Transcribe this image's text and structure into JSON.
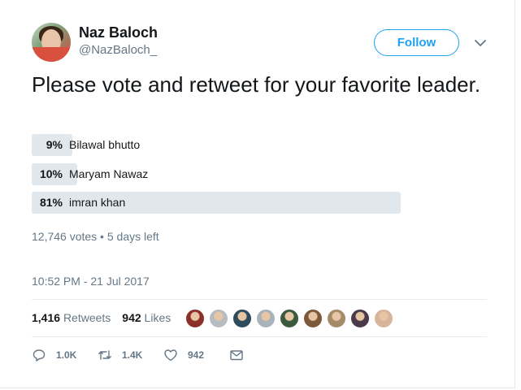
{
  "author": {
    "name": "Naz Baloch",
    "handle": "@NazBaloch_"
  },
  "follow_label": "Follow",
  "tweet_text": "Please vote and retweet for your favorite leader.",
  "poll": {
    "options": [
      {
        "pct_label": "9%",
        "label": "Bilawal bhutto",
        "pct": 9
      },
      {
        "pct_label": "10%",
        "label": "Maryam Nawaz",
        "pct": 10
      },
      {
        "pct_label": "81%",
        "label": "imran khan",
        "pct": 81
      }
    ],
    "meta": "12,746 votes • 5 days left"
  },
  "timestamp": "10:52 PM - 21 Jul 2017",
  "stats": {
    "retweets_count": "1,416",
    "retweets_label": "Retweets",
    "likes_count": "942",
    "likes_label": "Likes"
  },
  "liker_avatar_colors": [
    "#8b2f2a",
    "#b6bcc2",
    "#2f4a5a",
    "#aab2ba",
    "#3a5a3e",
    "#7a5a3a",
    "#a58a6a",
    "#4a3a4a",
    "#d8b49a"
  ],
  "actions": {
    "reply_count": "1.0K",
    "retweet_count": "1.4K",
    "like_count": "942"
  },
  "colors": {
    "accent": "#1da1f2",
    "secondary_text": "#657786",
    "poll_bar": "#e1e8ed"
  },
  "icons": [
    "chevron-down-icon",
    "reply-icon",
    "retweet-icon",
    "heart-icon",
    "mail-icon"
  ]
}
